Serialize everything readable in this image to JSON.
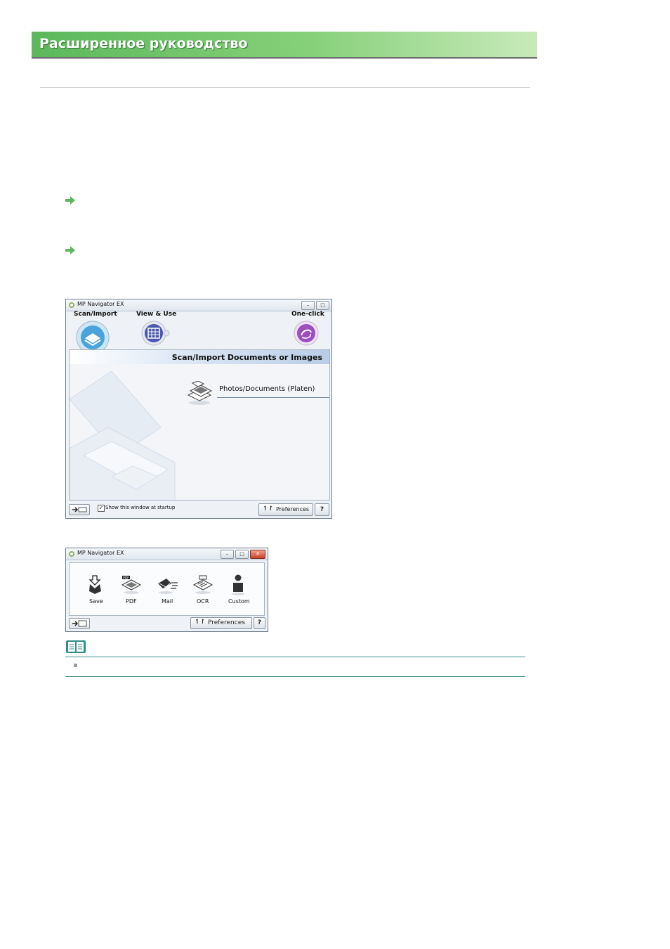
{
  "banner": {
    "title": "Расширенное руководство"
  },
  "big_window": {
    "title": "MP Navigator EX",
    "tabs": [
      {
        "label": "Scan/Import"
      },
      {
        "label": "View & Use"
      },
      {
        "label": "One-click"
      }
    ],
    "section_header": "Scan/Import Documents or Images",
    "option": "Photos/Documents (Platen)",
    "checkbox_label": "Show this window at startup",
    "checkbox_checked": true,
    "preferences_label": "Preferences",
    "help_label": "?"
  },
  "small_window": {
    "title": "MP Navigator EX",
    "items": [
      {
        "label": "Save",
        "icon": "save-icon"
      },
      {
        "label": "PDF",
        "icon": "pdf-icon"
      },
      {
        "label": "Mail",
        "icon": "mail-icon"
      },
      {
        "label": "OCR",
        "icon": "ocr-icon"
      },
      {
        "label": "Custom",
        "icon": "custom-icon"
      }
    ],
    "preferences_label": "Preferences",
    "help_label": "?"
  },
  "colors": {
    "banner": "#5cb85c",
    "arrow": "#5cb85c",
    "note_rule": "#3b8c8c"
  }
}
